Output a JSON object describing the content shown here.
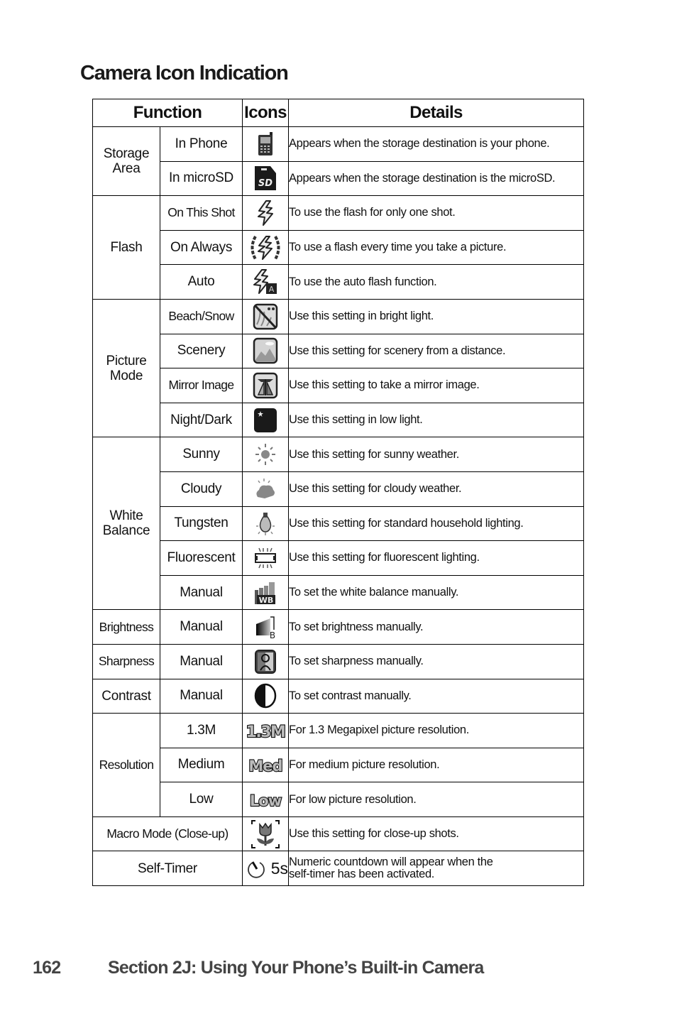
{
  "page": {
    "title": "Camera Icon Indication",
    "footer": {
      "page_number": "162",
      "section": "Section 2J: Using Your Phone’s Built-in Camera"
    }
  },
  "table": {
    "headers": {
      "function": "Function",
      "icons": "Icons",
      "details": "Details"
    },
    "rows": [
      {
        "category": "Storage Area",
        "setting": "In Phone",
        "icon": "phone-icon",
        "details": "Appears when the storage destination is your phone."
      },
      {
        "category": "Storage Area",
        "setting": "In microSD",
        "icon": "microsd-card-icon",
        "details": "Appears when the storage destination is the microSD."
      },
      {
        "category": "Flash",
        "setting": "On This Shot",
        "icon": "flash-icon",
        "details": "To use the flash for only one shot."
      },
      {
        "category": "Flash",
        "setting": "On Always",
        "icon": "flash-always-icon",
        "details": "To use a flash every time you take a picture."
      },
      {
        "category": "Flash",
        "setting": "Auto",
        "icon": "flash-auto-icon",
        "details": "To use the auto flash function."
      },
      {
        "category": "Picture Mode",
        "setting": "Beach/Snow",
        "icon": "beach-snow-icon",
        "details": "Use this setting in bright light."
      },
      {
        "category": "Picture Mode",
        "setting": "Scenery",
        "icon": "scenery-icon",
        "details": "Use this setting for scenery from a distance."
      },
      {
        "category": "Picture Mode",
        "setting": "Mirror Image",
        "icon": "mirror-image-icon",
        "details": "Use this setting to take a mirror image."
      },
      {
        "category": "Picture Mode",
        "setting": "Night/Dark",
        "icon": "night-moon-icon",
        "details": "Use this setting in low light."
      },
      {
        "category": "White Balance",
        "setting": "Sunny",
        "icon": "sun-icon",
        "details": "Use this setting for sunny weather."
      },
      {
        "category": "White Balance",
        "setting": "Cloudy",
        "icon": "cloudy-icon",
        "details": "Use this setting for cloudy weather."
      },
      {
        "category": "White Balance",
        "setting": "Tungsten",
        "icon": "light-bulb-icon",
        "details": "Use this setting for standard household lighting."
      },
      {
        "category": "White Balance",
        "setting": "Fluorescent",
        "icon": "fluorescent-tube-icon",
        "details": "Use this setting for fluorescent lighting."
      },
      {
        "category": "White Balance",
        "setting": "Manual",
        "icon": "white-balance-manual-icon",
        "icon_text": "WB",
        "details": "To set the white balance manually."
      },
      {
        "category": "Brightness",
        "setting": "Manual",
        "icon": "brightness-icon",
        "icon_text": "B",
        "details": "To set brightness manually."
      },
      {
        "category": "Sharpness",
        "setting": "Manual",
        "icon": "sharpness-icon",
        "details": "To set sharpness manually."
      },
      {
        "category": "Contrast",
        "setting": "Manual",
        "icon": "contrast-icon",
        "details": "To set contrast manually."
      },
      {
        "category": "Resolution",
        "setting": "1.3M",
        "icon": "resolution-1-3m-icon",
        "icon_text": "1.3M",
        "details": "For 1.3 Megapixel picture resolution."
      },
      {
        "category": "Resolution",
        "setting": "Medium",
        "icon": "resolution-medium-icon",
        "icon_text": "Med",
        "details": "For medium picture resolution."
      },
      {
        "category": "Resolution",
        "setting": "Low",
        "icon": "resolution-low-icon",
        "icon_text": "Low",
        "details": "For low picture resolution."
      },
      {
        "category": "Macro Mode (Close-up)",
        "setting": "",
        "icon": "macro-tulip-icon",
        "details": "Use this setting for close-up shots."
      },
      {
        "category": "Self-Timer",
        "setting": "",
        "icon": "self-timer-icon",
        "icon_text": "5s",
        "details_line1": "Numeric countdown will appear when the",
        "details_line2": "self-timer has been activated."
      }
    ]
  }
}
